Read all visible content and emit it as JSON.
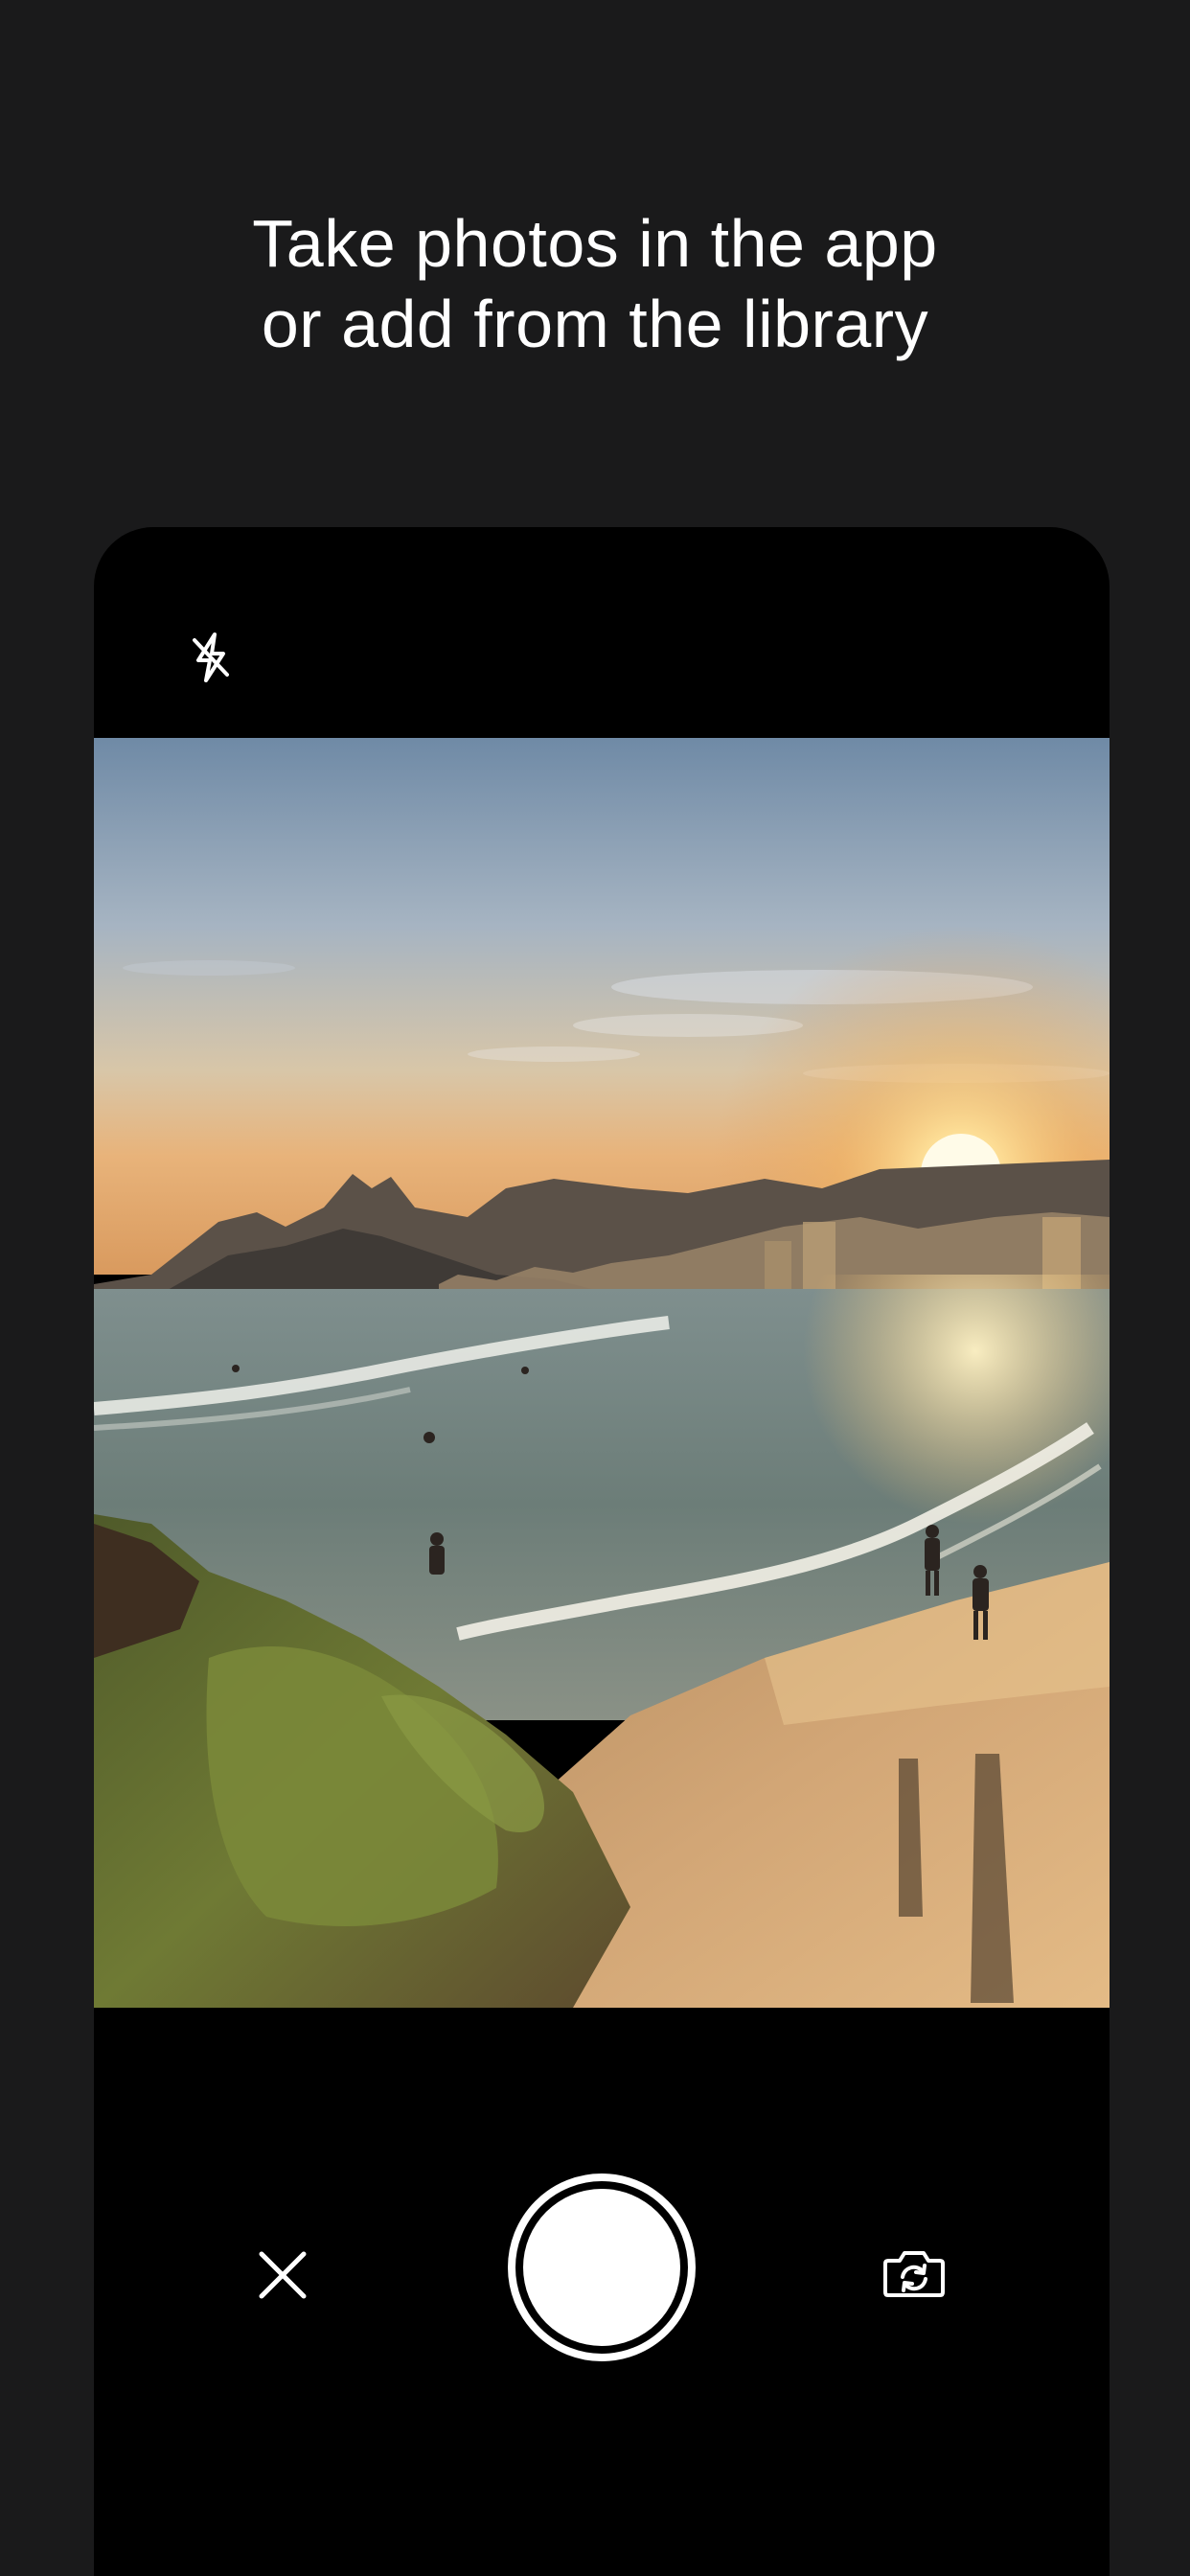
{
  "onboarding": {
    "headline": "Take photos in the app\nor add from the library"
  },
  "camera": {
    "flash_icon": "flash-off-icon",
    "close_icon": "close-icon",
    "shutter_icon": "shutter-button",
    "flip_icon": "flip-camera-icon",
    "viewfinder_subject": "beach sunset photo"
  },
  "colors": {
    "background": "#1a1a1b",
    "camera_frame": "#000000",
    "foreground": "#ffffff"
  }
}
